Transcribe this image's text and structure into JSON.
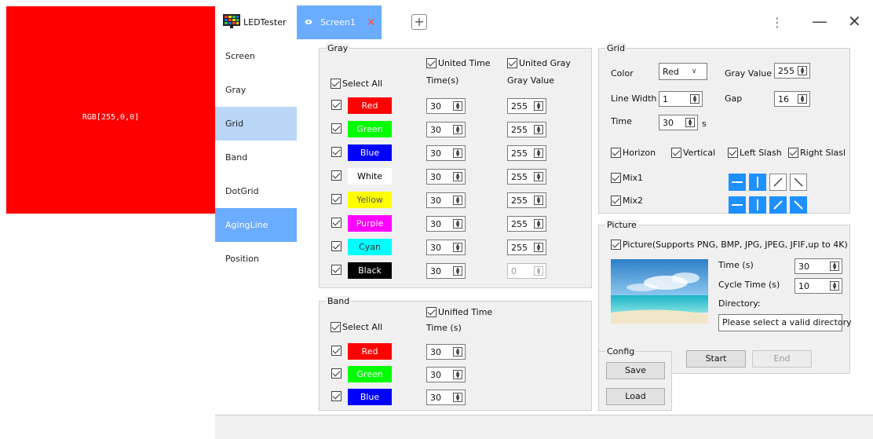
{
  "preview": {
    "label": "RGB[255,0,0]",
    "color": "#ff0000"
  },
  "brand": {
    "name": "LEDTester",
    "icon": "led-grid-icon"
  },
  "tabs": [
    {
      "label": "Screen1"
    }
  ],
  "window": {
    "more": "⋮",
    "minimize": "—",
    "close": "✕",
    "add_tab": "+"
  },
  "sidebar": {
    "items": [
      {
        "label": "Screen"
      },
      {
        "label": "Gray"
      },
      {
        "label": "Grid"
      },
      {
        "label": "Band"
      },
      {
        "label": "DotGrid"
      },
      {
        "label": "AgingLine"
      },
      {
        "label": "Position"
      }
    ]
  },
  "gray": {
    "title": "Gray",
    "united_time": "United Time",
    "united_gray": "United Gray",
    "select_all": "Select All",
    "col_time": "Time(s)",
    "col_gray": "Gray Value",
    "rows": [
      {
        "name": "Red",
        "bg": "#ff0000",
        "fg": "#ffffff",
        "time": "30",
        "gray": "255",
        "gray_disabled": false
      },
      {
        "name": "Green",
        "bg": "#00ff00",
        "fg": "#ffffff",
        "time": "30",
        "gray": "255",
        "gray_disabled": false
      },
      {
        "name": "Blue",
        "bg": "#0000ff",
        "fg": "#ffffff",
        "time": "30",
        "gray": "255",
        "gray_disabled": false
      },
      {
        "name": "White",
        "bg": "#ffffff",
        "fg": "#000000",
        "time": "30",
        "gray": "255",
        "gray_disabled": false
      },
      {
        "name": "Yellow",
        "bg": "#ffff00",
        "fg": "#555555",
        "time": "30",
        "gray": "255",
        "gray_disabled": false
      },
      {
        "name": "Purple",
        "bg": "#ff00ff",
        "fg": "#ffffff",
        "time": "30",
        "gray": "255",
        "gray_disabled": false
      },
      {
        "name": "Cyan",
        "bg": "#00ffff",
        "fg": "#333333",
        "time": "30",
        "gray": "255",
        "gray_disabled": false
      },
      {
        "name": "Black",
        "bg": "#000000",
        "fg": "#ffffff",
        "time": "30",
        "gray": "0",
        "gray_disabled": true
      }
    ]
  },
  "band": {
    "title": "Band",
    "unified_time": "Unified Time",
    "select_all": "Select All",
    "col_time": "Time (s)",
    "rows": [
      {
        "name": "Red",
        "bg": "#ff0000",
        "fg": "#ffffff",
        "time": "30"
      },
      {
        "name": "Green",
        "bg": "#00ff00",
        "fg": "#ffffff",
        "time": "30"
      },
      {
        "name": "Blue",
        "bg": "#0000ff",
        "fg": "#ffffff",
        "time": "30"
      }
    ]
  },
  "grid": {
    "title": "Grid",
    "color_label": "Color",
    "color_value": "Red",
    "gray_value_label": "Gray Value",
    "gray_value": "255",
    "line_width_label": "Line Width",
    "line_width": "1",
    "gap_label": "Gap",
    "gap": "16",
    "time_label": "Time",
    "time": "30",
    "time_unit": "s",
    "horizon": "Horizon",
    "vertical": "Vertical",
    "left_slash": "Left Slash",
    "right_slash": "Right Slasl",
    "mix1": "Mix1",
    "mix2": "Mix2",
    "accent": "#1e90ff"
  },
  "picture": {
    "title": "Picture",
    "checkbox": "Picture(Supports PNG, BMP, JPG, JPEG, JFIF,up to 4K)",
    "time_label": "Time (s)",
    "time": "30",
    "cycle_label": "Cycle Time (s)",
    "cycle": "10",
    "directory_label": "Directory:",
    "directory_value": "Please select a valid directory"
  },
  "config": {
    "title": "Config",
    "save": "Save",
    "load": "Load"
  },
  "actions": {
    "start": "Start",
    "end": "End"
  }
}
